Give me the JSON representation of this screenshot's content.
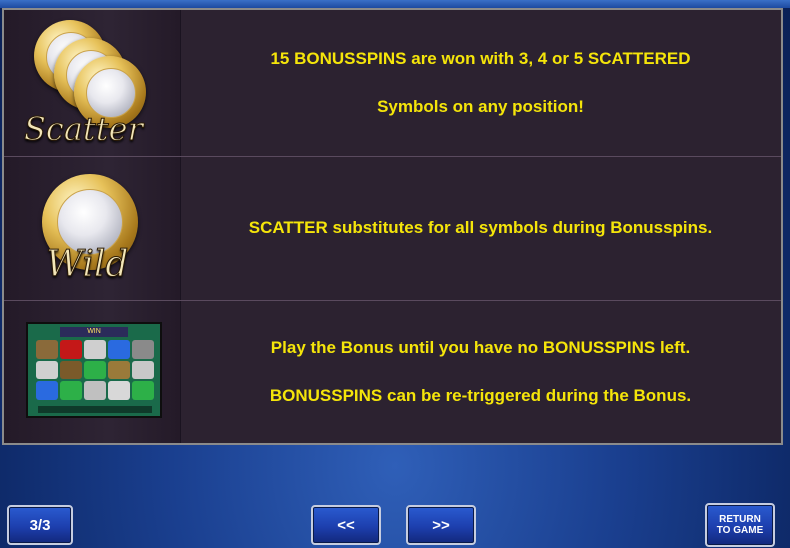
{
  "rows": [
    {
      "icon": "scatter-symbol",
      "icon_label": "Scatter",
      "lines": [
        "15 BONUSSPINS are won with 3, 4 or 5 SCATTERED",
        "Symbols on any position!"
      ]
    },
    {
      "icon": "wild-symbol",
      "icon_label": "Wild",
      "lines": [
        "SCATTER substitutes for all symbols during Bonusspins."
      ]
    },
    {
      "icon": "bonus-screen-thumbnail",
      "icon_label": "WIN",
      "lines": [
        "Play the Bonus until you have no BONUSSPINS left.",
        "BONUSSPINS can be re-triggered during the Bonus."
      ]
    }
  ],
  "footer": {
    "page": "3/3",
    "prev": "<<",
    "next": ">>",
    "return_line1": "RETURN",
    "return_line2": "TO GAME"
  },
  "colors": {
    "text": "#f5e50a",
    "panel": "#2c2230",
    "button": "#1d3fae"
  }
}
